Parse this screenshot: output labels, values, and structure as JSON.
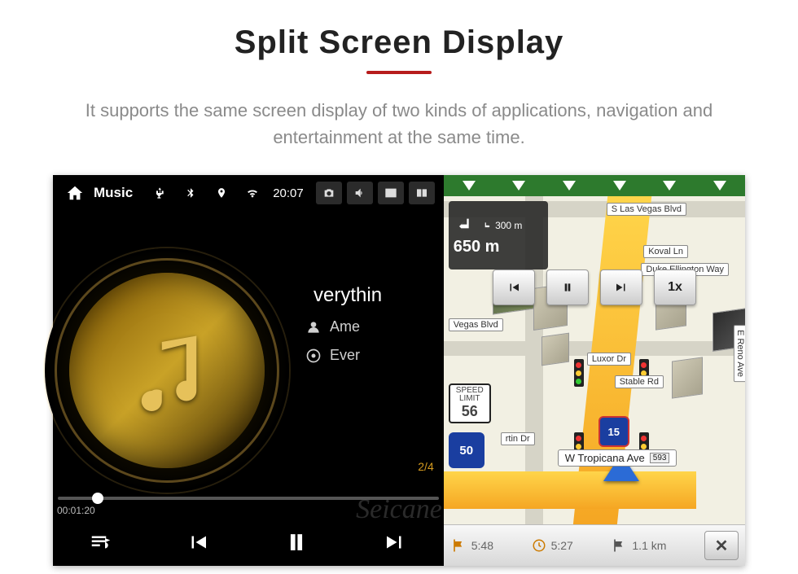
{
  "page": {
    "title": "Split Screen Display",
    "subtitle": "It supports the same screen display of two kinds of applications, navigation and entertainment at the same time."
  },
  "watermark": "Seicane",
  "topbar": {
    "music_label": "Music",
    "clock": "20:07"
  },
  "player": {
    "title": "verythin",
    "artist": "Ame",
    "album": "Ever",
    "counter": "2/4",
    "time_elapsed": "00:01:20",
    "time_total": ""
  },
  "nav": {
    "turn_distance_1": "300 m",
    "turn_distance_2": "650 m",
    "speed_limit_label": "SPEED LIMIT",
    "speed_limit_value": "56",
    "route_shield": "50",
    "interstate": "15",
    "streets": {
      "top": "S Las Vegas Blvd",
      "koval": "Koval Ln",
      "duke": "Duke Ellington Way",
      "vegas": "Vegas Blvd",
      "luxor": "Luxor Dr",
      "stable": "Stable Rd",
      "reno": "E Reno Ave",
      "martin": "rtin Dr",
      "tropicana": "W Tropicana Ave",
      "tropicana_badge": "593"
    },
    "play_speed": "1x",
    "bottom": {
      "eta": "5:48",
      "time": "5:27",
      "dist": "1.1 km"
    }
  }
}
